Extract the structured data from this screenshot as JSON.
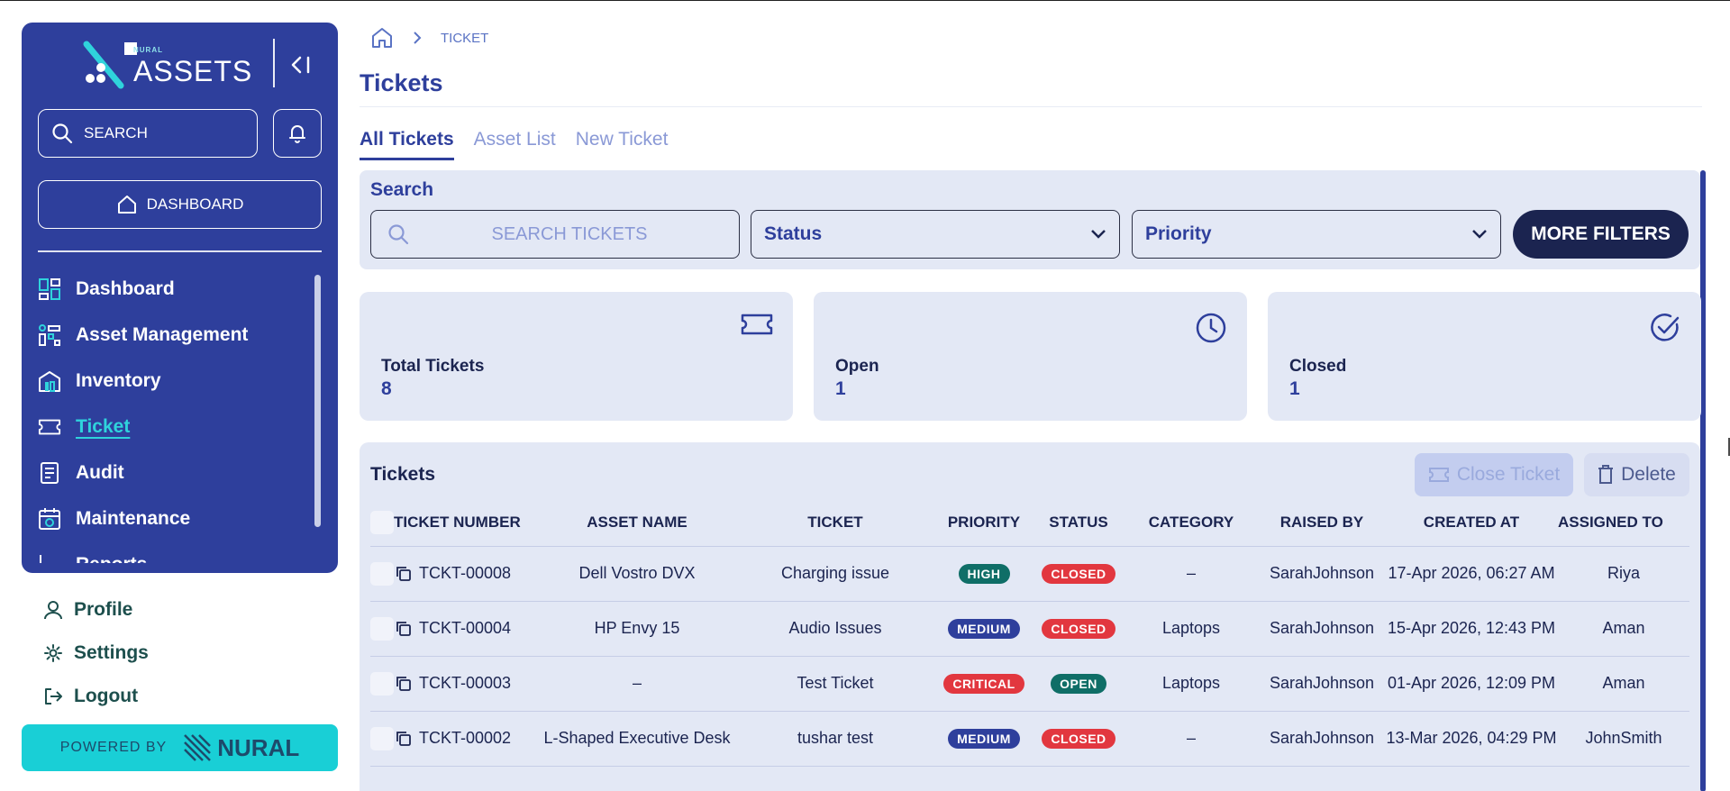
{
  "sidebar": {
    "logo_small": "NURAL",
    "logo_text": "ASSETS",
    "search_label": "SEARCH",
    "dashboard_button": "DASHBOARD",
    "nav_items": [
      {
        "label": "Dashboard",
        "icon": "dashboard-icon"
      },
      {
        "label": "Asset Management",
        "icon": "asset-management-icon"
      },
      {
        "label": "Inventory",
        "icon": "inventory-icon"
      },
      {
        "label": "Ticket",
        "icon": "ticket-icon",
        "active": true
      },
      {
        "label": "Audit",
        "icon": "audit-icon"
      },
      {
        "label": "Maintenance",
        "icon": "maintenance-icon"
      },
      {
        "label": "Reports",
        "icon": "reports-icon"
      }
    ],
    "bottom_links": [
      {
        "label": "Profile",
        "icon": "user-icon"
      },
      {
        "label": "Settings",
        "icon": "gear-icon"
      },
      {
        "label": "Logout",
        "icon": "logout-icon"
      }
    ],
    "powered_by": "POWERED BY",
    "powered_brand": "NURAL"
  },
  "breadcrumb": {
    "current": "TICKET"
  },
  "page": {
    "title": "Tickets"
  },
  "tabs": [
    "All Tickets",
    "Asset List",
    "New Ticket"
  ],
  "filters": {
    "label": "Search",
    "search_placeholder": "SEARCH TICKETS",
    "status": "Status",
    "priority": "Priority",
    "more_filters": "MORE FILTERS"
  },
  "stats": [
    {
      "label": "Total Tickets",
      "value": "8",
      "icon": "ticket-icon"
    },
    {
      "label": "Open",
      "value": "1",
      "icon": "clock-icon"
    },
    {
      "label": "Closed",
      "value": "1",
      "icon": "check-circle-icon"
    }
  ],
  "tickets_panel": {
    "title": "Tickets",
    "close_ticket": "Close Ticket",
    "delete": "Delete",
    "columns": [
      "TICKET NUMBER",
      "ASSET NAME",
      "TICKET",
      "PRIORITY",
      "STATUS",
      "CATEGORY",
      "RAISED BY",
      "CREATED AT",
      "ASSIGNED TO"
    ],
    "rows": [
      {
        "number": "TCKT-00008",
        "asset": "Dell Vostro DVX",
        "ticket": "Charging issue",
        "priority": "HIGH",
        "status": "CLOSED",
        "category": "–",
        "raised_by": "SarahJohnson",
        "created_at": "17-Apr 2026, 06:27 AM",
        "assigned_to": "Riya"
      },
      {
        "number": "TCKT-00004",
        "asset": "HP Envy 15",
        "ticket": "Audio Issues",
        "priority": "MEDIUM",
        "status": "CLOSED",
        "category": "Laptops",
        "raised_by": "SarahJohnson",
        "created_at": "15-Apr 2026, 12:43 PM",
        "assigned_to": "Aman"
      },
      {
        "number": "TCKT-00003",
        "asset": "–",
        "ticket": "Test Ticket",
        "priority": "CRITICAL",
        "status": "OPEN",
        "category": "Laptops",
        "raised_by": "SarahJohnson",
        "created_at": "01-Apr 2026, 12:09 PM",
        "assigned_to": "Aman"
      },
      {
        "number": "TCKT-00002",
        "asset": "L-Shaped Executive Desk",
        "ticket": "tushar test",
        "priority": "MEDIUM",
        "status": "CLOSED",
        "category": "–",
        "raised_by": "SarahJohnson",
        "created_at": "13-Mar 2026, 04:29 PM",
        "assigned_to": "JohnSmith"
      }
    ]
  },
  "colors": {
    "sidebar_bg": "#2e3f9c",
    "accent_cyan": "#19cfd6",
    "panel_bg": "#e3e8f5",
    "dark_button": "#1b2450",
    "badge_red": "#e2373f",
    "badge_teal": "#0f6e67"
  }
}
